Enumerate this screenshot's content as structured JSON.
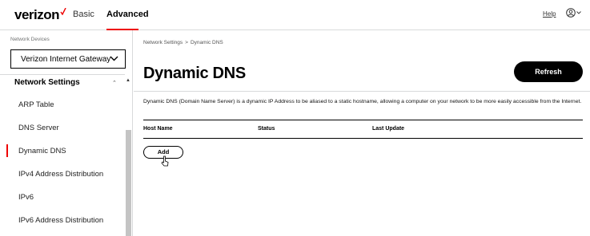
{
  "header": {
    "brand": "verizon",
    "nav": {
      "basic": "Basic",
      "advanced": "Advanced"
    },
    "help_label": "Help",
    "accent_color": "#ee0000",
    "user_icon": "user-circle-icon"
  },
  "sidebar": {
    "caption": "Network Devices",
    "device_select_value": "Verizon Internet Gateway",
    "section_title": "Network Settings",
    "items": [
      {
        "label": "ARP Table"
      },
      {
        "label": "DNS Server"
      },
      {
        "label": "Dynamic DNS",
        "active": true
      },
      {
        "label": "IPv4 Address Distribution"
      },
      {
        "label": "IPv6"
      },
      {
        "label": "IPv6 Address Distribution"
      }
    ]
  },
  "main": {
    "breadcrumb": [
      "Network Settings",
      "Dynamic DNS"
    ],
    "breadcrumb_sep": ">",
    "title": "Dynamic DNS",
    "refresh_label": "Refresh",
    "description": "Dynamic DNS (Domain Name Server) is a dynamic IP Address to be aliased to a static hostname, allowing a computer on your network to be more easily accessible from the Internet.",
    "table": {
      "columns": [
        "Host Name",
        "Status",
        "Last Update"
      ],
      "rows": []
    },
    "add_label": "Add"
  }
}
